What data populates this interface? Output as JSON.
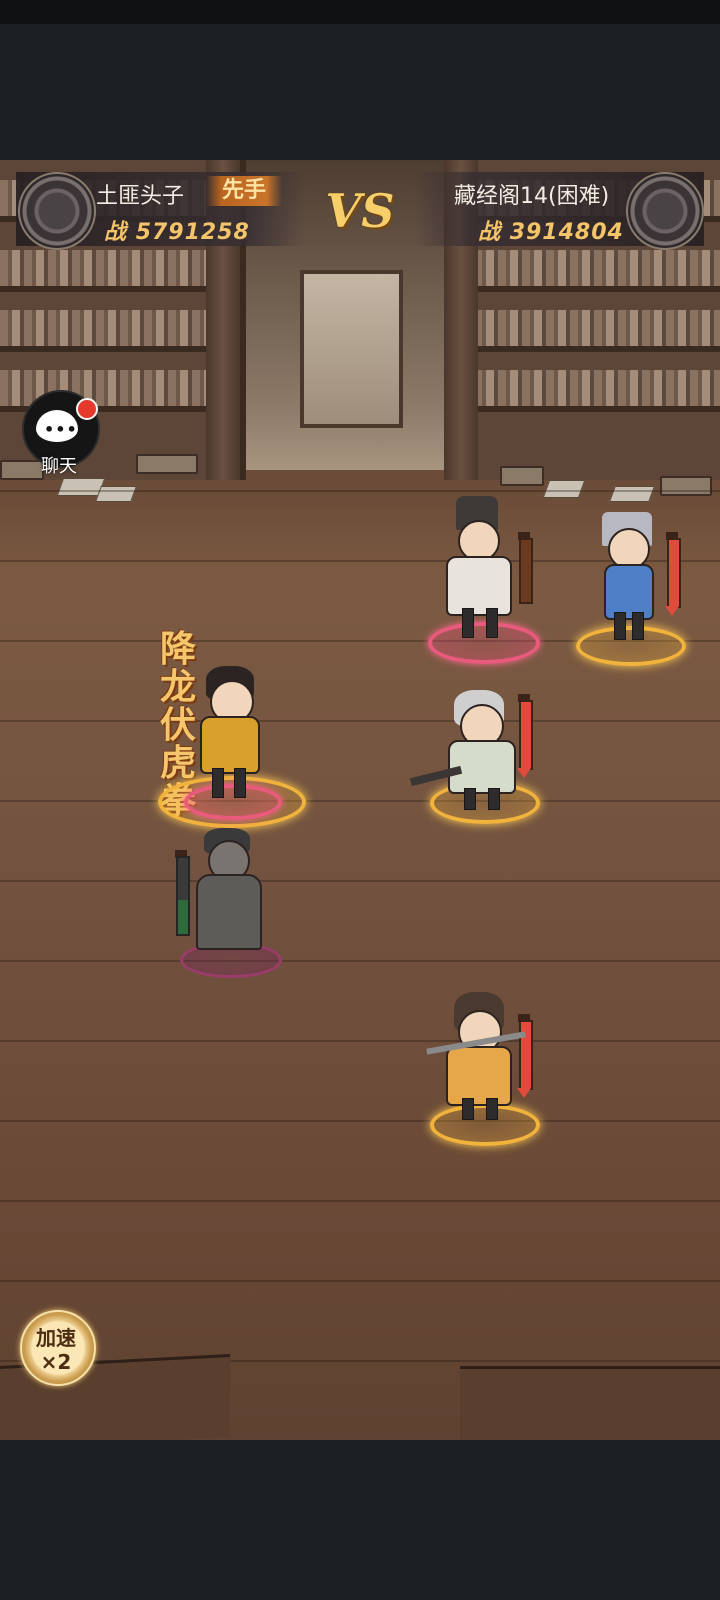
{
  "header": {
    "player": {
      "name": "土匪头子",
      "power_label": "战",
      "power": "5791258",
      "first_move": "先手"
    },
    "vs": "VS",
    "enemy": {
      "name": "藏经阁14(困难)",
      "power_label": "战",
      "power": "3914804"
    }
  },
  "chat": {
    "label": "聊天",
    "has_notification": true
  },
  "battle": {
    "skill_name": [
      "降",
      "龙",
      "伏",
      "虎",
      "拳"
    ],
    "allies": [
      {
        "id": "ally-1",
        "role": "fighter-yellow",
        "hp": 1.0
      },
      {
        "id": "ally-2",
        "role": "shadow-caster",
        "hp": 0.45
      }
    ],
    "enemies": [
      {
        "id": "enemy-1",
        "role": "scholar",
        "hp": 1.0
      },
      {
        "id": "enemy-2",
        "role": "blue-maiden",
        "hp": 1.0
      },
      {
        "id": "enemy-3",
        "role": "old-monk",
        "hp": 1.0
      },
      {
        "id": "enemy-4",
        "role": "young-swordsman",
        "hp": 1.0
      }
    ]
  },
  "speed": {
    "line1": "加速",
    "line2": "×2"
  },
  "colors": {
    "gold": "#f6cf6a",
    "hp_red": "#e04b3b",
    "ring_gold": "#f1b33c",
    "ring_red": "#ea5a7d"
  }
}
